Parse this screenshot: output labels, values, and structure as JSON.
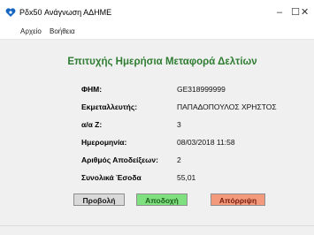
{
  "window": {
    "title": "Pδx50 Ανάγνωση ΑΔΗΜΕ",
    "controls": {
      "minimize": "–",
      "maximize": "☐",
      "close": "✕"
    }
  },
  "menu": {
    "file": "Αρχείο",
    "help": "Βοήθεια"
  },
  "heading": "Επιτυχής Ημερήσια Μεταφορά Δελτίων",
  "fields": [
    {
      "label": "ΦΗΜ:",
      "value": "GE318999999"
    },
    {
      "label": "Εκμεταλλευτής:",
      "value": "ΠΑΠΑΔΟΠΟΥΛΟΣ ΧΡΗΣΤΟΣ"
    },
    {
      "label": "α/α Ζ:",
      "value": "3"
    },
    {
      "label": "Ημερομηνία:",
      "value": "08/03/2018 11:58"
    },
    {
      "label": "Αριθμός Αποδείξεων:",
      "value": "2"
    },
    {
      "label": "Συνολικά Έσοδα",
      "value": "55,01"
    }
  ],
  "buttons": {
    "preview": "Προβολή",
    "accept": "Αποδοχή",
    "reject": "Απόρριψη"
  },
  "colors": {
    "heading": "#2e7d32",
    "accept": "#7fe07f",
    "reject": "#f39a7d",
    "preview": "#d9d9d9"
  },
  "icons": {
    "app": "blue-heart-icon"
  }
}
